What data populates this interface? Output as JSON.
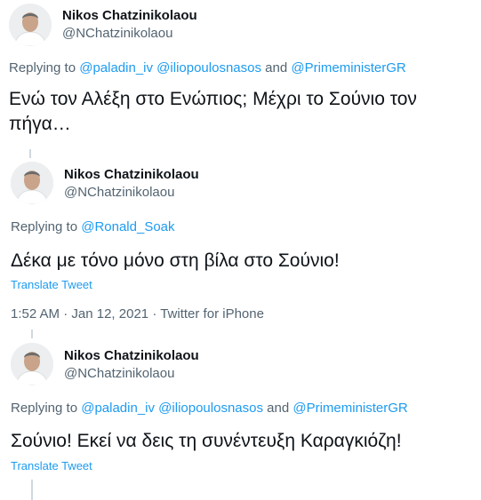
{
  "colors": {
    "link": "#1d9bf0",
    "secondary": "#536471",
    "text": "#0f1419",
    "thread_line": "#cfd9de"
  },
  "tweets": [
    {
      "author_name": "Nikos Chatzinikolaou",
      "author_handle": "@NChatzinikolaou",
      "reply_prefix": "Replying to",
      "mentions": [
        "@paladin_iv",
        "@iliopoulosnasos",
        "@PrimeministerGR"
      ],
      "mention_joiner": "and",
      "text": "Ενώ τον Αλέξη στο Ενώπιος; Μέχρι το Σούνιο τον πήγα…"
    },
    {
      "author_name": "Nikos Chatzinikolaou",
      "author_handle": "@NChatzinikolaou",
      "reply_prefix": "Replying to",
      "mentions": [
        "@Ronald_Soak"
      ],
      "text": "Δέκα με τόνο μόνο στη βίλα στο Σούνιο!",
      "translate_label": "Translate Tweet",
      "time": "1:52 AM",
      "date": "Jan 12, 2021",
      "source": "Twitter for iPhone",
      "separator": "·"
    },
    {
      "author_name": "Nikos Chatzinikolaou",
      "author_handle": "@NChatzinikolaou",
      "reply_prefix": "Replying to",
      "mentions": [
        "@paladin_iv",
        "@iliopoulosnasos",
        "@PrimeministerGR"
      ],
      "mention_joiner": "and",
      "text": "Σούνιο! Εκεί να δεις τη συνέντευξη Καραγκιόζη!",
      "translate_label": "Translate Tweet"
    }
  ]
}
